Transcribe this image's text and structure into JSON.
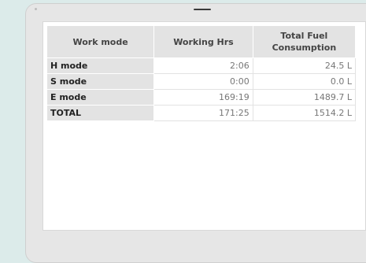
{
  "table": {
    "headers": {
      "work_mode": "Work mode",
      "working_hrs": "Working Hrs",
      "total_fuel_line1": "Total Fuel",
      "total_fuel_line2": "Consumption"
    },
    "rows": [
      {
        "mode": "H mode",
        "hours": "2:06",
        "fuel": "24.5 L"
      },
      {
        "mode": "S mode",
        "hours": "0:00",
        "fuel": "0.0 L"
      },
      {
        "mode": "E mode",
        "hours": "169:19",
        "fuel": "1489.7 L"
      },
      {
        "mode": "TOTAL",
        "hours": "171:25",
        "fuel": "1514.2 L"
      }
    ]
  }
}
